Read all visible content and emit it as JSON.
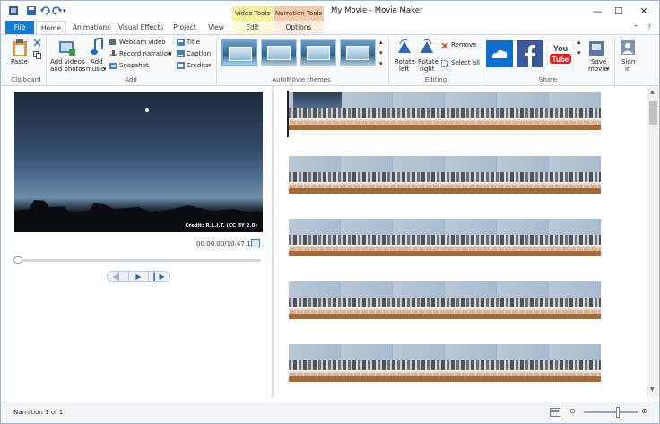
{
  "window": {
    "title": "My Movie - Movie Maker",
    "context_video": "Video Tools",
    "context_narration": "Narration Tools"
  },
  "tabs": {
    "file": "File",
    "home": "Home",
    "animations": "Animations",
    "visual_effects": "Visual Effects",
    "project": "Project",
    "view": "View",
    "edit": "Edit",
    "options": "Options"
  },
  "clipboard": {
    "paste": "Paste",
    "label": "Clipboard"
  },
  "add": {
    "videos_line1": "Add videos",
    "videos_line2": "and photos",
    "music_line1": "Add",
    "music_line2": "music",
    "webcam": "Webcam video",
    "narration": "Record narration",
    "snapshot": "Snapshot",
    "title": "Title",
    "caption": "Caption",
    "credits": "Credits",
    "label": "Add"
  },
  "automovie": {
    "label": "AutoMovie themes"
  },
  "editing": {
    "rotate_left_1": "Rotate",
    "rotate_left_2": "left",
    "rotate_right_1": "Rotate",
    "rotate_right_2": "right",
    "remove": "Remove",
    "select_all": "Select all",
    "label": "Editing"
  },
  "share": {
    "save_1": "Save",
    "save_2": "movie",
    "signin_1": "Sign",
    "signin_2": "in",
    "label": "Share",
    "youtube": "You Tube"
  },
  "preview": {
    "credit": "Credit: R.L.I.T. (CC BY 2.0)",
    "time": "00:00.00/10:47.12"
  },
  "status": {
    "text": "Narration 1 of 1"
  },
  "colors": {
    "file_tab": "#1979ca",
    "narration_track": "#a46a3a",
    "video_tools": "#f6ef9b",
    "narration_tools": "#f8c9a8"
  }
}
